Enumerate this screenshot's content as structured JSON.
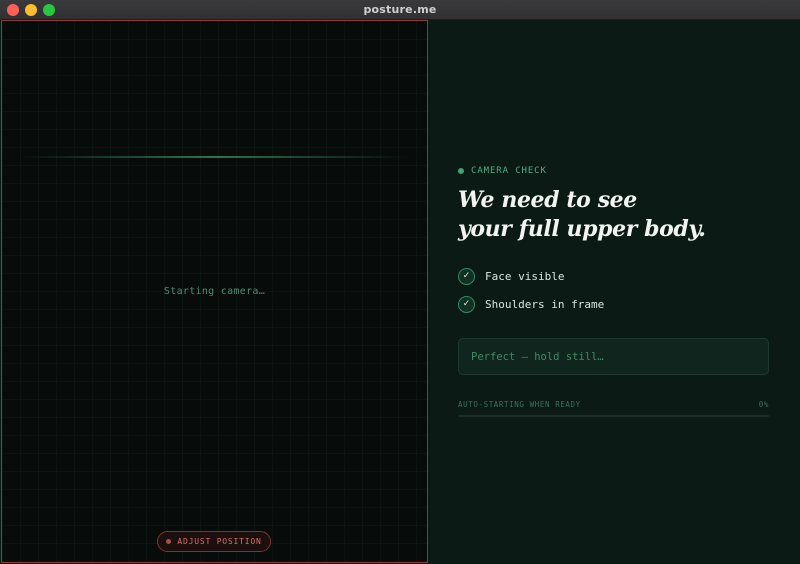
{
  "window": {
    "title": "posture.me"
  },
  "camera": {
    "status": "Starting camera…",
    "adjust_button_label": "ADJUST POSITION"
  },
  "panel": {
    "eyebrow": "CAMERA CHECK",
    "headline_line1": "We need to see",
    "headline_line2": "your full upper body.",
    "checklist": [
      {
        "label": "Face visible",
        "checked": true,
        "icon": "checkmark-icon"
      },
      {
        "label": "Shoulders in frame",
        "checked": true,
        "icon": "checkmark-icon"
      }
    ],
    "status_message": "Perfect — hold still…",
    "progress": {
      "label": "AUTO-STARTING WHEN READY",
      "percent_text": "0%",
      "value": 0
    }
  },
  "colors": {
    "accent": "#3fa175",
    "warning_border": "#8a3b36",
    "background": "#0c1a16"
  }
}
